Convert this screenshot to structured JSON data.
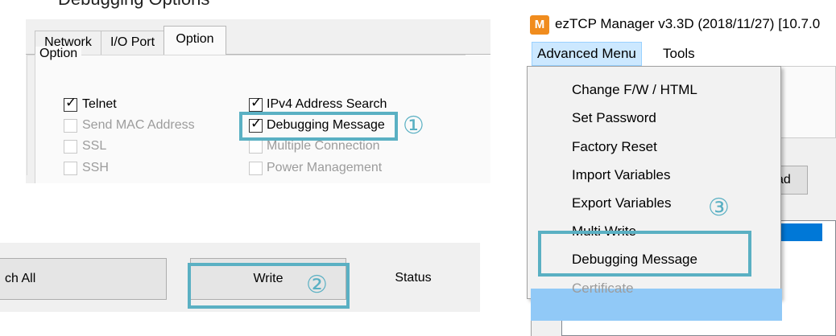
{
  "top_text": "Debugging Options",
  "option_panel": {
    "tabs": [
      "Network",
      "I/O Port",
      "Option"
    ],
    "active_tab": "Option",
    "group_label": "Option",
    "checkboxes_left": [
      {
        "label": "Telnet",
        "checked": true,
        "enabled": true
      },
      {
        "label": "Send MAC Address",
        "checked": false,
        "enabled": false
      },
      {
        "label": "SSL",
        "checked": false,
        "enabled": false
      },
      {
        "label": "SSH",
        "checked": false,
        "enabled": false
      }
    ],
    "checkboxes_right": [
      {
        "label": "IPv4 Address Search",
        "checked": true,
        "enabled": true
      },
      {
        "label": "Debugging Message",
        "checked": true,
        "enabled": true
      },
      {
        "label": "Multiple Connection",
        "checked": false,
        "enabled": false
      },
      {
        "label": "Power Management",
        "checked": false,
        "enabled": false
      }
    ],
    "callout": "①",
    "check_glyph": "✓"
  },
  "button_bar": {
    "search_all_partial": "ch All",
    "write": "Write",
    "status": "Status",
    "callout": "②"
  },
  "manager": {
    "icon_letter": "M",
    "title": "ezTCP Manager v3.3D (2018/11/27) [10.7.0",
    "menus": [
      "Advanced Menu",
      "Tools"
    ],
    "dropdown_items": [
      {
        "label": "Change F/W / HTML",
        "enabled": true
      },
      {
        "label": "Set Password",
        "enabled": true
      },
      {
        "label": "Factory Reset",
        "enabled": true
      },
      {
        "label": "Import Variables",
        "enabled": true
      },
      {
        "label": "Export Variables",
        "enabled": true
      },
      {
        "label": "Multi Write",
        "enabled": true
      },
      {
        "label": "Debugging Message",
        "enabled": true
      },
      {
        "label": "Certificate",
        "enabled": false
      }
    ],
    "bg_button_partial": "ad",
    "callout": "③"
  },
  "colors": {
    "highlight": "#5ab0c3",
    "menu_hover": "#91c9f7",
    "selection": "#0078d7"
  }
}
